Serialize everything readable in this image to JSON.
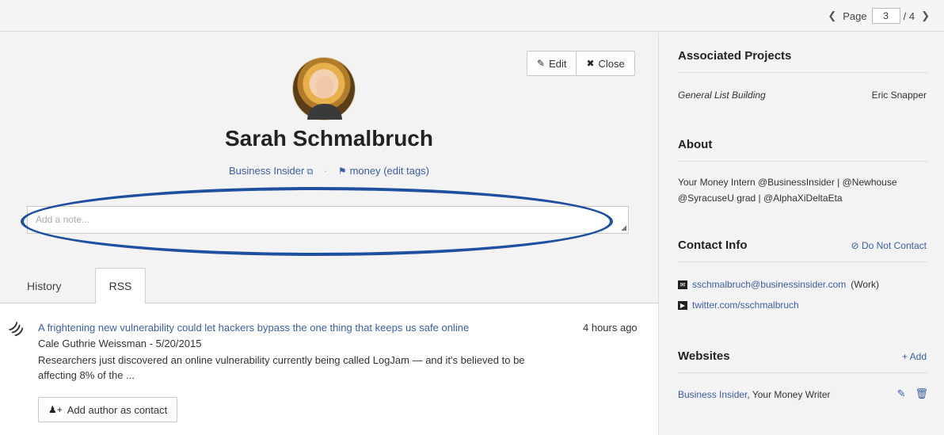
{
  "pager": {
    "label": "Page",
    "current": "3",
    "total": "/ 4",
    "prev_icon": "chevron-left-icon",
    "next_icon": "chevron-right-icon"
  },
  "toolbar": {
    "edit_label": "Edit",
    "close_label": "Close"
  },
  "profile": {
    "name": "Sarah Schmalbruch",
    "outlet": "Business Insider",
    "tags": "money (edit tags)"
  },
  "note": {
    "placeholder": "Add a note..."
  },
  "tabs": [
    {
      "label": "History"
    },
    {
      "label": "RSS"
    }
  ],
  "feed": {
    "items": [
      {
        "title": "A frightening new vulnerability could let hackers bypass the one thing that keeps us safe online",
        "time": "4 hours ago",
        "author": "Cale Guthrie Weissman - 5/20/2015",
        "summary": "Researchers just discovered an online vulnerability currently being called LogJam — and it's believed to be affecting 8% of the ..."
      }
    ],
    "add_author_label": "Add author as contact"
  },
  "sidebar": {
    "projects": {
      "title": "Associated Projects",
      "items": [
        {
          "name": "General List Building",
          "owner": "Eric Snapper"
        }
      ]
    },
    "about": {
      "title": "About",
      "text": "Your Money Intern @BusinessInsider | @Newhouse @SyracuseU grad | @AlphaXiDeltaEta"
    },
    "contact": {
      "title": "Contact Info",
      "action": "Do Not Contact",
      "email": "sschmalbruch@businessinsider.com",
      "email_type": "(Work)",
      "twitter": "twitter.com/sschmalbruch"
    },
    "websites": {
      "title": "Websites",
      "action": "Add",
      "items": [
        {
          "name": "Business Insider",
          "role": ", Your Money Writer"
        }
      ]
    }
  },
  "colors": {
    "link": "#3a5ea8",
    "annotation": "#1e4fa0"
  }
}
